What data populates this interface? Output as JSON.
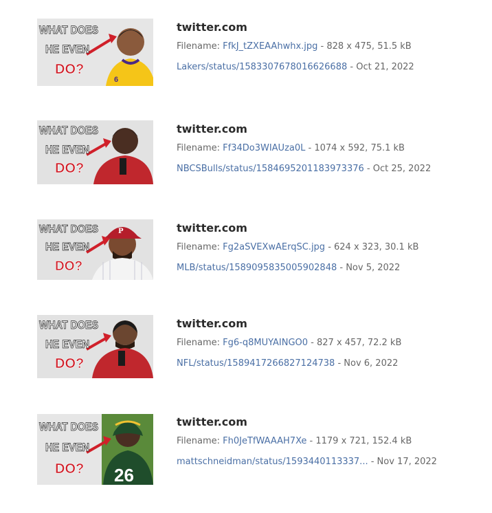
{
  "results": [
    {
      "site": "twitter.com",
      "filename_label": "Filename: ",
      "filename": "FfkJ_tZXEAAhwhx.jpg",
      "file_info": " - 828 x 475, 51.5 kB",
      "status_link": "Lakers/status/1583307678016626688",
      "date": " - Oct 21, 2022",
      "thumb_text": [
        "WHAT DOES",
        "HE EVEN",
        "DO?"
      ],
      "jersey": "6",
      "colors": {
        "shirt": "#f5c518",
        "bg": "#e6e6e6"
      }
    },
    {
      "site": "twitter.com",
      "filename_label": "Filename: ",
      "filename": "Ff34Do3WIAUza0L",
      "file_info": " - 1074 x 592, 75.1 kB",
      "status_link": "NBCSBulls/status/1584695201183973376",
      "date": " - Oct 25, 2022",
      "thumb_text": [
        "WHAT DOES",
        "HE EVEN",
        "DO?"
      ],
      "colors": {
        "shirt": "#c0272d",
        "bg": "#e2e2e2"
      }
    },
    {
      "site": "twitter.com",
      "filename_label": "Filename: ",
      "filename": "Fg2aSVEXwAErqSC.jpg",
      "file_info": " - 624 x 323, 30.1 kB",
      "status_link": "MLB/status/1589095835005902848",
      "date": " - Nov 5, 2022",
      "thumb_text": [
        "WHAT DOES",
        "HE EVEN",
        "DO?"
      ],
      "colors": {
        "shirt": "#f4f4f4",
        "bg": "#e2e2e2"
      }
    },
    {
      "site": "twitter.com",
      "filename_label": "Filename: ",
      "filename": "Fg6-q8MUYAINGO0",
      "file_info": " - 827 x 457, 72.2 kB",
      "status_link": "NFL/status/1589417266827124738",
      "date": " - Nov 6, 2022",
      "thumb_text": [
        "WHAT DOES",
        "HE EVEN",
        "DO?"
      ],
      "colors": {
        "shirt": "#c0272d",
        "bg": "#e2e2e2"
      }
    },
    {
      "site": "twitter.com",
      "filename_label": "Filename: ",
      "filename": "Fh0JeTfWAAAH7Xe",
      "file_info": " - 1179 x 721, 152.4 kB",
      "status_link": "mattschneidman/status/1593440113337...",
      "date": " - Nov 17, 2022",
      "thumb_text": [
        "WHAT DOES",
        "HE EVEN",
        "DO?"
      ],
      "jersey": "26",
      "colors": {
        "shirt": "#1f4d2b",
        "bg": "#5a8a3a"
      }
    }
  ]
}
